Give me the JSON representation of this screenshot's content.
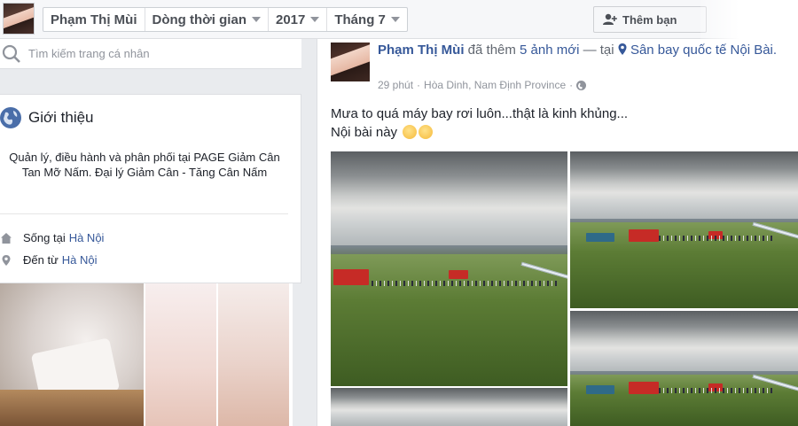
{
  "topbar": {
    "crumbs": [
      {
        "label": "Phạm Thị Mùi",
        "has_caret": false
      },
      {
        "label": "Dòng thời gian",
        "has_caret": true
      },
      {
        "label": "2017",
        "has_caret": true
      },
      {
        "label": "Tháng 7",
        "has_caret": true
      }
    ],
    "add_friend_label": "Thêm bạn"
  },
  "sidebar": {
    "search_placeholder": "Tìm kiếm trang cá nhân",
    "intro": {
      "title": "Giới thiệu",
      "bio": "Quản lý, điều hành và phân phối tại PAGE Giảm Cân Tan Mỡ Nấm. Đại lý Giảm Cân - Tăng Cân Nấm",
      "lives_label": "Sống tại",
      "lives_value": "Hà Nội",
      "from_label": "Đến từ",
      "from_value": "Hà Nội"
    }
  },
  "post": {
    "author": "Phạm Thị Mùi",
    "action": "đã thêm",
    "photos_link": "5 ảnh mới",
    "at_text": "— tại",
    "place": "Sân bay quốc tế Nội Bài.",
    "time": "29 phút",
    "location": "Hòa Dinh, Nam Định Province",
    "line1": "Mưa to quá máy bay rơi luôn...thật là kinh khủng...",
    "line2": "Nội bài này"
  },
  "colors": {
    "link": "#365899",
    "topbar_bg": "#f6f7f9",
    "page_bg": "#e9ebee"
  }
}
